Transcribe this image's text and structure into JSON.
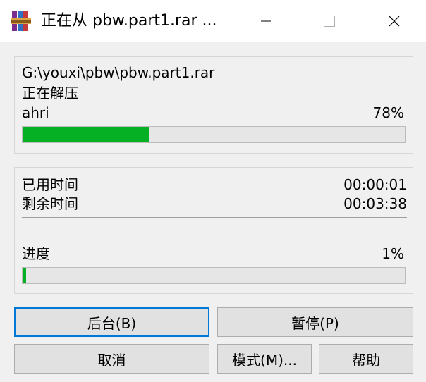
{
  "titlebar": {
    "title": "正在从 pbw.part1.rar ...",
    "app_icon": "winrar-icon",
    "buttons": [
      "minimize-icon",
      "maximize-icon",
      "close-icon"
    ]
  },
  "extract": {
    "path": "G:\\youxi\\pbw\\pbw.part1.rar",
    "status": "正在解压",
    "file": "ahri",
    "file_percent": "78%",
    "file_progress": 0.33
  },
  "timing": {
    "elapsed_label": "已用时间",
    "elapsed_value": "00:00:01",
    "remaining_label": "剩余时间",
    "remaining_value": "00:03:38",
    "progress_label": "进度",
    "progress_percent": "1%",
    "overall_progress": 0.01
  },
  "buttons": {
    "background": "后台(B)",
    "pause": "暂停(P)",
    "cancel": "取消",
    "mode": "模式(M)...",
    "help": "帮助"
  },
  "colors": {
    "progress_green": "#06b025",
    "focus_blue": "#0078d7"
  }
}
